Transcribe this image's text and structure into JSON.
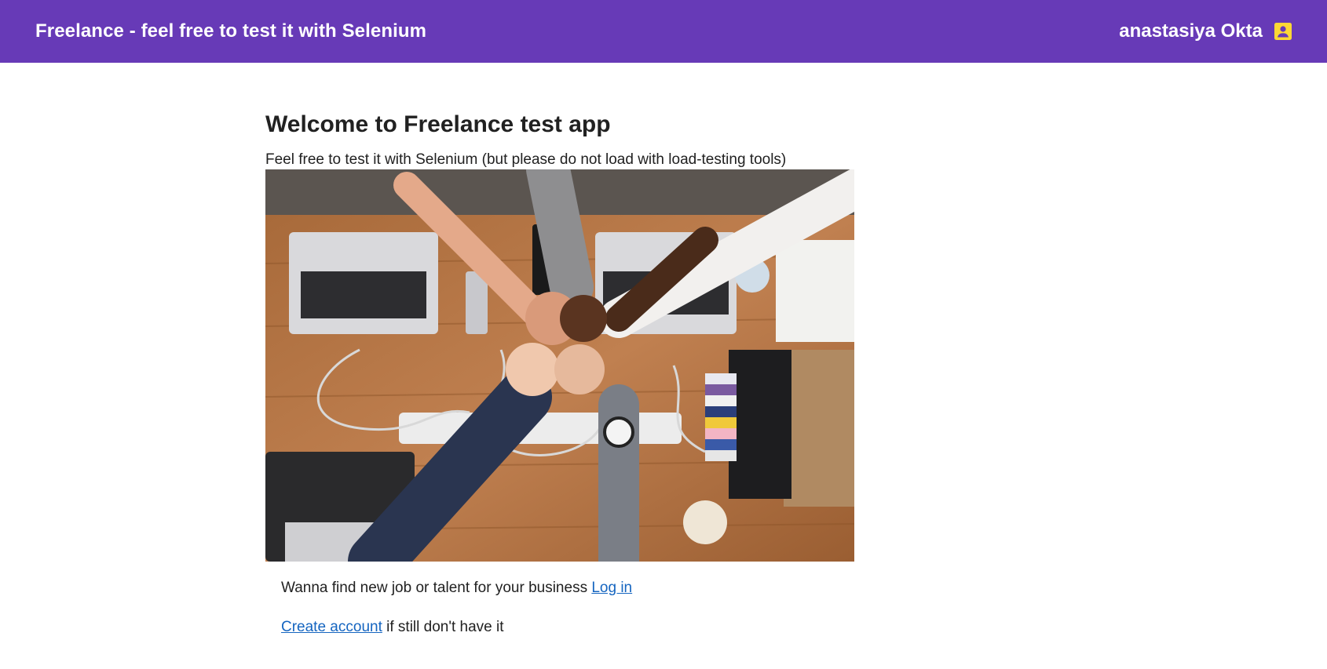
{
  "header": {
    "title": "Freelance - feel free to test it with Selenium",
    "user_name": "anastasiya Okta",
    "user_icon": "account-box-icon",
    "background_color": "#673ab7",
    "icon_color": "#fdd835"
  },
  "main": {
    "heading": "Welcome to Freelance test app",
    "subtitle": "Feel free to test it with Selenium (but please do not load with load-testing tools)",
    "hero_image": "team-fist-bump-photo",
    "cta_line1_text": "Wanna find new job or talent for your business",
    "login_link": "Log in",
    "create_account_link": "Create account",
    "cta_line2_text": " if still don't have it",
    "link_color": "#1565c0"
  }
}
